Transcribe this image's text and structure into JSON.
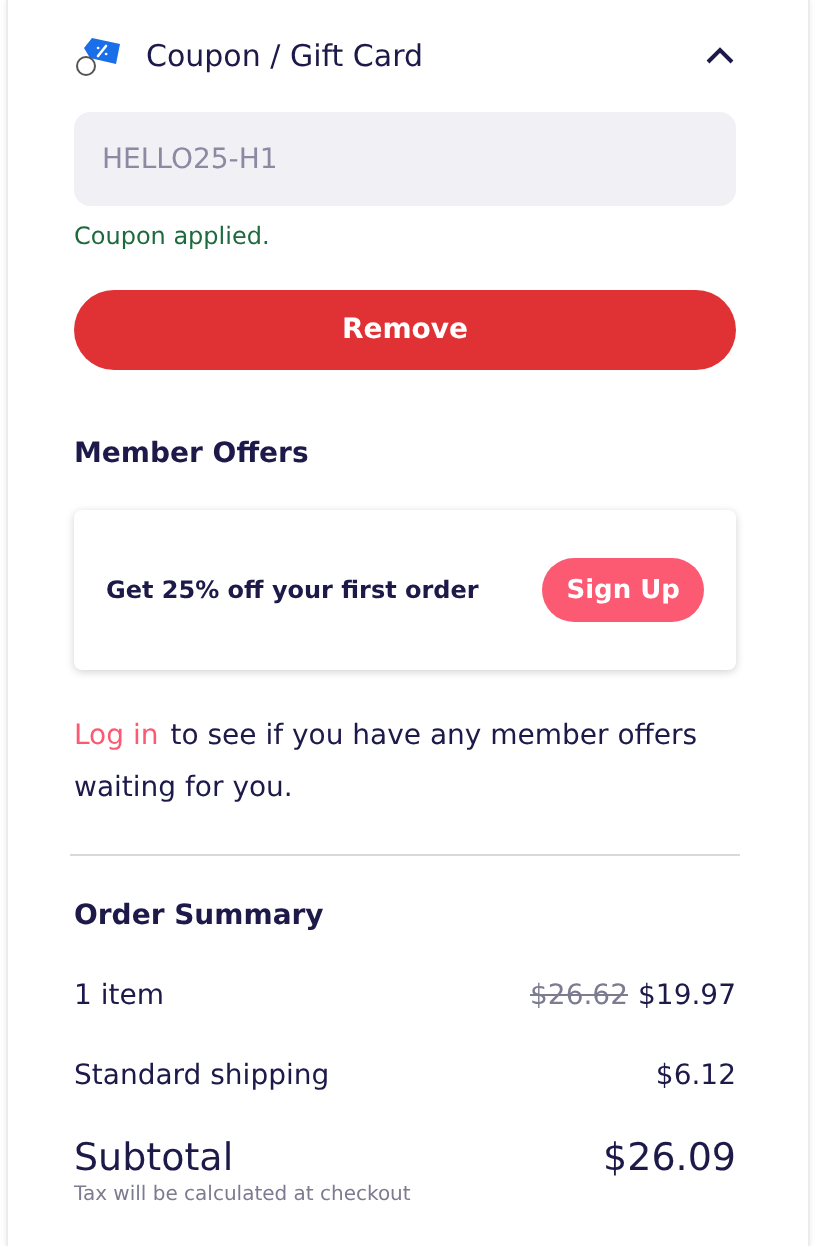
{
  "coupon": {
    "title": "Coupon / Gift Card",
    "expanded": true,
    "code": "HELLO25-H1",
    "status": "Coupon applied.",
    "button": "Remove"
  },
  "member_offers": {
    "title": "Member Offers",
    "offer": "Get 25% off your first order",
    "offer_button": "Sign Up",
    "login_link": "Log in",
    "login_text": "to see if you have any member offers waiting for you."
  },
  "order_summary": {
    "title": "Order Summary",
    "rows": [
      {
        "label": "1 item",
        "old_price": "$26.62",
        "price": "$19.97"
      },
      {
        "label": "Standard shipping",
        "price": "$6.12"
      }
    ],
    "subtotal": {
      "label": "Subtotal",
      "note": "Tax will be calculated at checkout",
      "price": "$26.09"
    }
  }
}
